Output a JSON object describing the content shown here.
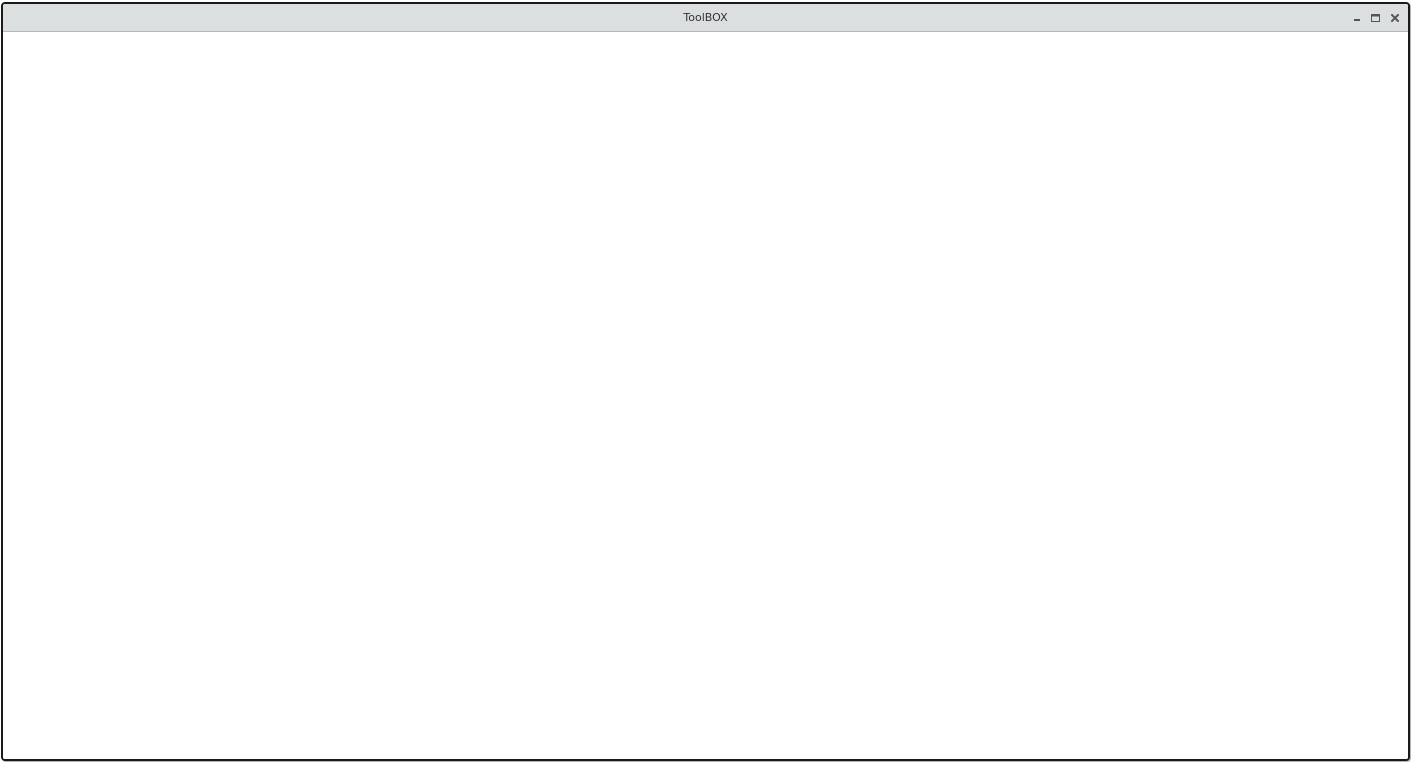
{
  "window": {
    "title": "ToolBOX",
    "controls": [
      {
        "name": "minimize",
        "icon": "minimize-icon"
      },
      {
        "name": "maximize",
        "icon": "maximize-icon"
      },
      {
        "name": "close",
        "icon": "close-icon"
      }
    ]
  },
  "colors": {
    "titlebar_bg": "#dcdfe0",
    "content_bg": "#ffffff",
    "border": "#1a1a1a",
    "title_text": "#333333",
    "control_icon": "#555555"
  }
}
